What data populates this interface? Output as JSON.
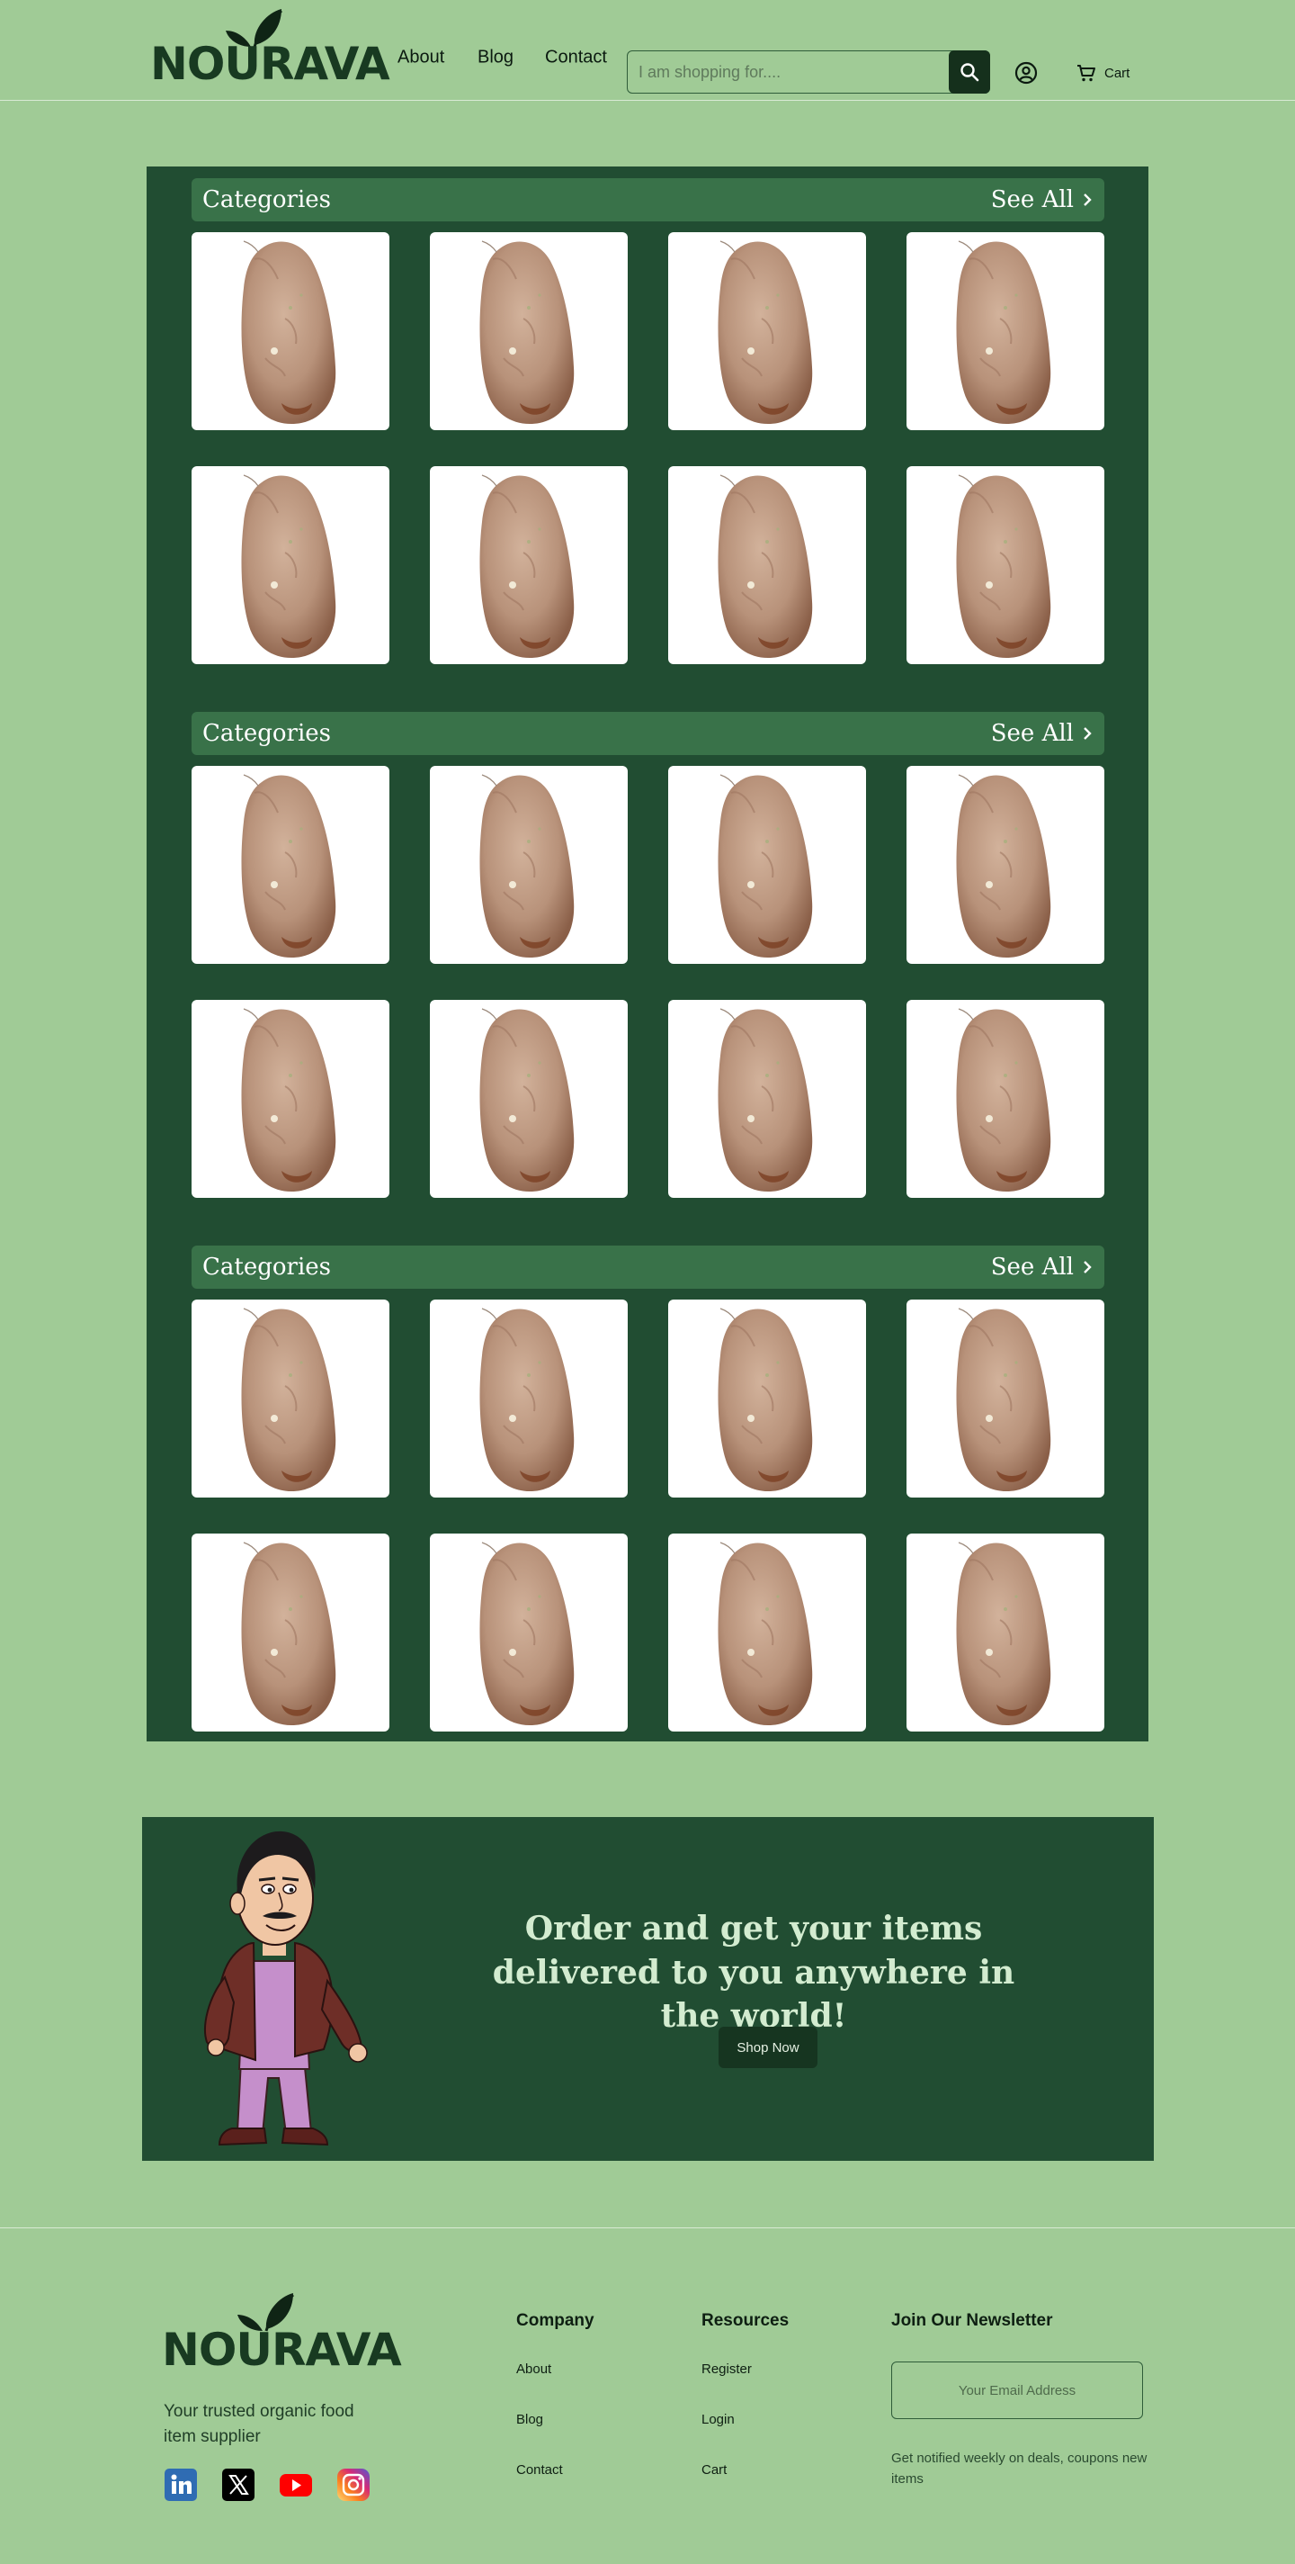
{
  "brand": {
    "name": "NOURAVA"
  },
  "header": {
    "nav": [
      "About",
      "Blog",
      "Contact"
    ],
    "search_placeholder": "I am shopping for....",
    "cart_label": "Cart"
  },
  "icons": {
    "search": "search-icon",
    "user": "user-circle-icon",
    "cart": "cart-icon",
    "see_all": "chevron-right-icon",
    "logo": "leaf-icon"
  },
  "categories": [
    {
      "title": "Categories",
      "see_all": "See All"
    },
    {
      "title": "Categories",
      "see_all": "See All"
    },
    {
      "title": "Categories",
      "see_all": "See All"
    }
  ],
  "banner": {
    "heading": "Order and get your items delivered to you anywhere in the world!",
    "button": "Shop Now"
  },
  "footer": {
    "tagline": "Your trusted organic food item supplier",
    "social": [
      "linkedin-icon",
      "x-icon",
      "youtube-icon",
      "instagram-icon"
    ],
    "columns": [
      {
        "title": "Company",
        "links": [
          "About",
          "Blog",
          "Contact"
        ]
      },
      {
        "title": "Resources",
        "links": [
          "Register",
          "Login",
          "Cart"
        ]
      }
    ],
    "newsletter": {
      "title": "Join Our Newsletter",
      "placeholder": "Your Email Address",
      "note": "Get notified weekly on deals, coupons new items"
    }
  },
  "colors": {
    "page_bg": "#a0cb96",
    "panel_bg": "#214d32",
    "section_bar": "#397249",
    "dark_button": "#15301c",
    "logo_text": "#183a21",
    "banner_heading": "#d3ecd0"
  }
}
